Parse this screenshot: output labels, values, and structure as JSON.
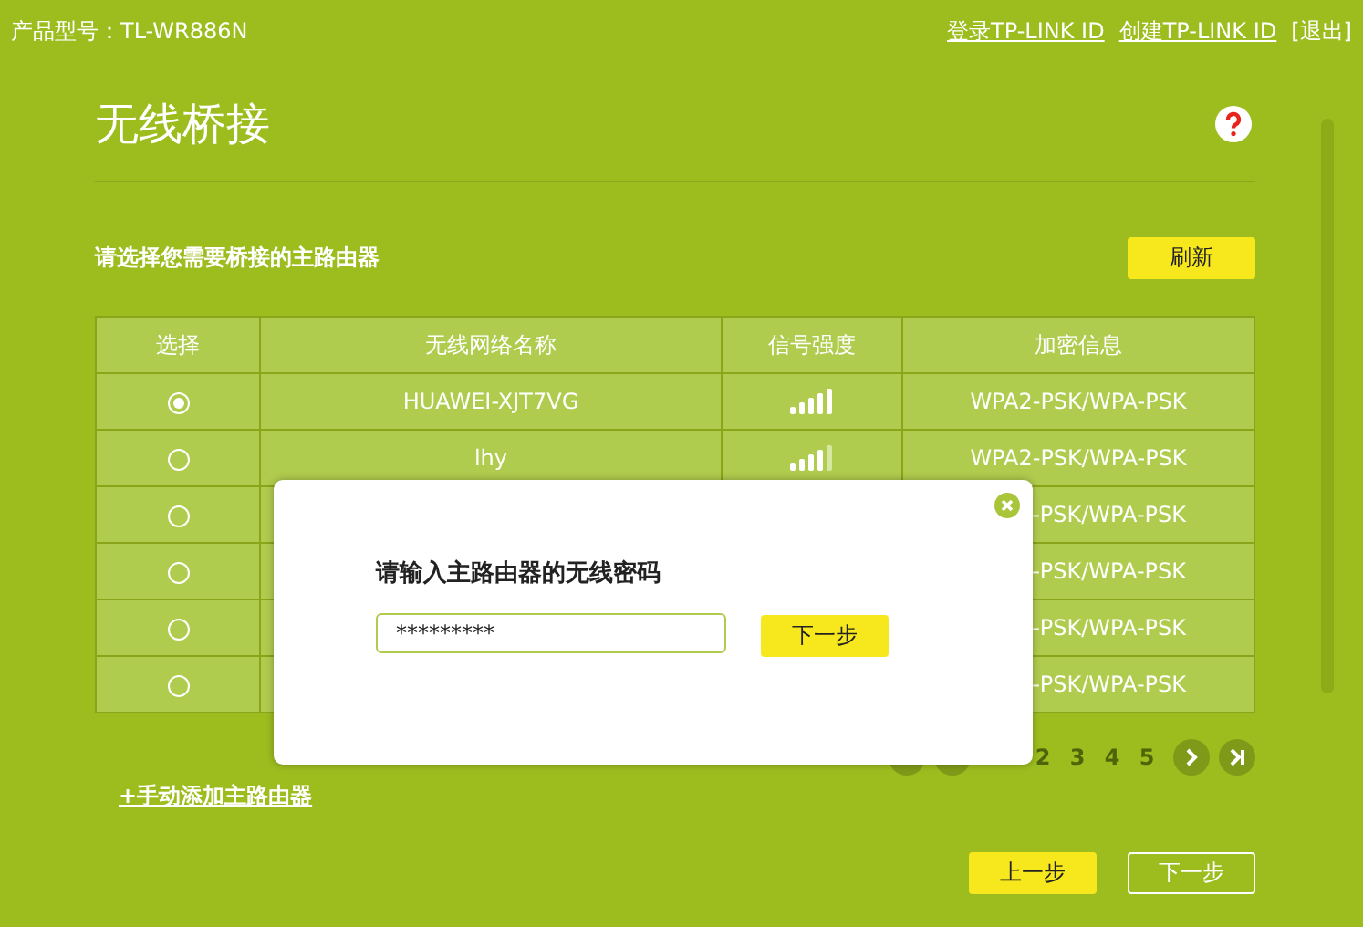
{
  "header": {
    "model": "产品型号：TL-WR886N",
    "links": [
      "登录TP-LINK ID",
      "创建TP-LINK ID",
      "[退出]"
    ]
  },
  "page": {
    "title": "无线桥接",
    "subtitle": "请选择您需要桥接的主路由器",
    "refresh_button": "刷新"
  },
  "table": {
    "columns": [
      "选择",
      "无线网络名称",
      "信号强度",
      "加密信息"
    ],
    "rows": [
      {
        "selected": true,
        "name": "HUAWEI-XJT7VG",
        "level": 1,
        "security": "WPA2-PSK/WPA-PSK"
      },
      {
        "selected": false,
        "name": "lhy",
        "level": 0.8,
        "security": "WPA2-PSK/WPA-PSK"
      },
      {
        "selected": false,
        "security": "-PSK/WPA-PSK"
      },
      {
        "selected": false,
        "security": "-PSK/WPA-PSK"
      },
      {
        "selected": false,
        "security": "-PSK/WPA-PSK"
      },
      {
        "selected": false,
        "security": "-PSK/WPA-PSK"
      }
    ]
  },
  "pagination": {
    "pages": [
      "2",
      "3",
      "4",
      "5"
    ]
  },
  "add_link": "+手动添加主路由器",
  "buttons": [
    {
      "label": "上一步",
      "kind": "primary"
    },
    {
      "label": "下一步",
      "kind": "outline"
    }
  ],
  "dialog": {
    "title": "请输入主路由器的无线密码",
    "value": "*********",
    "button": "下一步"
  }
}
